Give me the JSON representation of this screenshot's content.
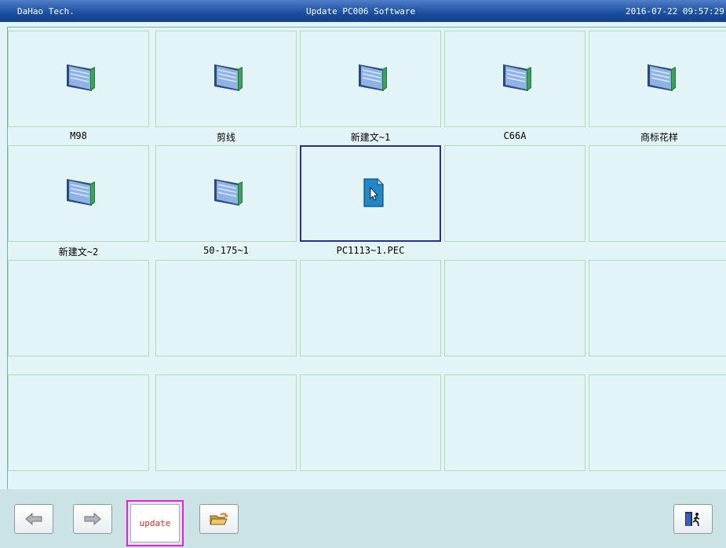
{
  "header": {
    "company": "DaHao Tech.",
    "title": "Update PC006 Software",
    "datetime": "2016-07-22 09:57:29"
  },
  "files": [
    {
      "name": "M98",
      "type": "folder-icon"
    },
    {
      "name": "剪线",
      "type": "folder-icon"
    },
    {
      "name": "新建文~1",
      "type": "folder-icon"
    },
    {
      "name": "C66A",
      "type": "folder-icon"
    },
    {
      "name": "商标花样",
      "type": "folder-icon"
    },
    {
      "name": "新建文~2",
      "type": "folder-icon"
    },
    {
      "name": "50-175~1",
      "type": "folder-icon"
    },
    {
      "name": "PC1113~1.PEC",
      "type": "file-icon",
      "selected": true
    }
  ],
  "toolbar": {
    "update_label": "update",
    "prev_icon": "arrow-left-icon",
    "next_icon": "arrow-right-icon",
    "open_icon": "open-folder-icon",
    "exit_icon": "exit-door-icon"
  },
  "colors": {
    "title_bar": "#1a4ea0",
    "background": "#e3f4f6",
    "selection_border": "#2a2e8c",
    "update_highlight": "#e61ce0",
    "update_text": "#e02828"
  }
}
